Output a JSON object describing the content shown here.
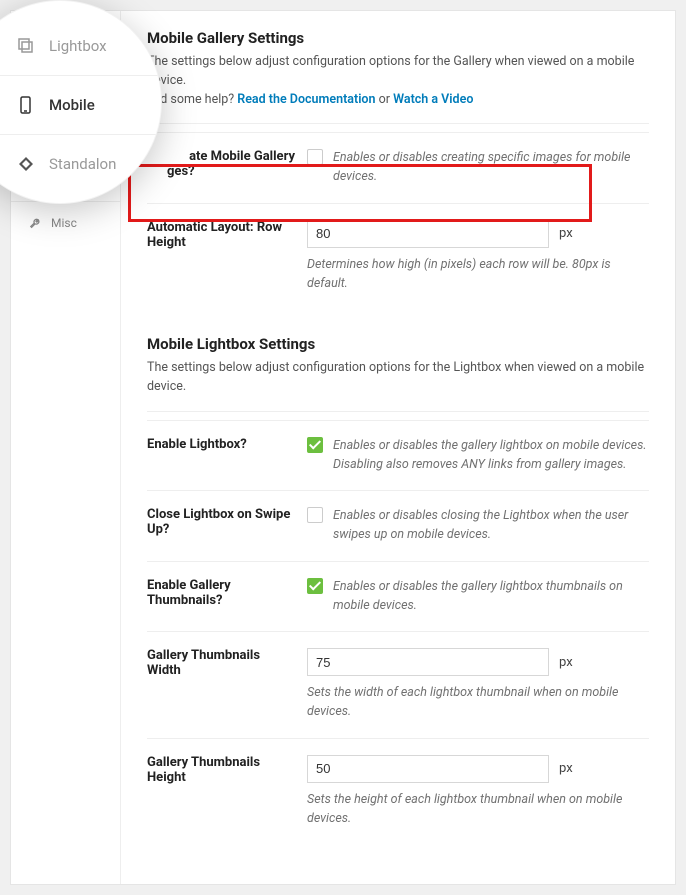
{
  "sidebar": {
    "items": [
      {
        "label": "Standalone"
      },
      {
        "label": "Misc"
      }
    ]
  },
  "magnifier": {
    "items": [
      {
        "label": "Lightbox"
      },
      {
        "label": "Mobile"
      },
      {
        "label": "Standalon"
      }
    ]
  },
  "gallery": {
    "title": "Mobile Gallery Settings",
    "intro_prefix": "The settings below adjust configuration options for the Gallery when viewed on a mobile device.",
    "help_prefix": "eed some help? ",
    "help_doc_link": "Read the Documentation",
    "help_or": " or ",
    "help_video_link": "Watch a Video",
    "rows": {
      "create_images": {
        "label_line1": "ate Mobile Gallery",
        "label_line2": "ges?",
        "desc": "Enables or disables creating specific images for mobile devices."
      },
      "row_height": {
        "label": "Automatic Layout: Row Height",
        "value": "80",
        "unit": "px",
        "desc": "Determines how high (in pixels) each row will be. 80px is default."
      }
    }
  },
  "lightbox": {
    "title": "Mobile Lightbox Settings",
    "intro": "The settings below adjust configuration options for the Lightbox when viewed on a mobile device.",
    "rows": {
      "enable": {
        "label": "Enable Lightbox?",
        "desc": "Enables or disables the gallery lightbox on mobile devices. Disabling also removes ANY links from gallery images."
      },
      "swipe": {
        "label": "Close Lightbox on Swipe Up?",
        "desc": "Enables or disables closing the Lightbox when the user swipes up on mobile devices."
      },
      "thumbs": {
        "label": "Enable Gallery Thumbnails?",
        "desc": "Enables or disables the gallery lightbox thumbnails on mobile devices."
      },
      "thumb_w": {
        "label": "Gallery Thumbnails Width",
        "value": "75",
        "unit": "px",
        "desc": "Sets the width of each lightbox thumbnail when on mobile devices."
      },
      "thumb_h": {
        "label": "Gallery Thumbnails Height",
        "value": "50",
        "unit": "px",
        "desc": "Sets the height of each lightbox thumbnail when on mobile devices."
      }
    }
  }
}
